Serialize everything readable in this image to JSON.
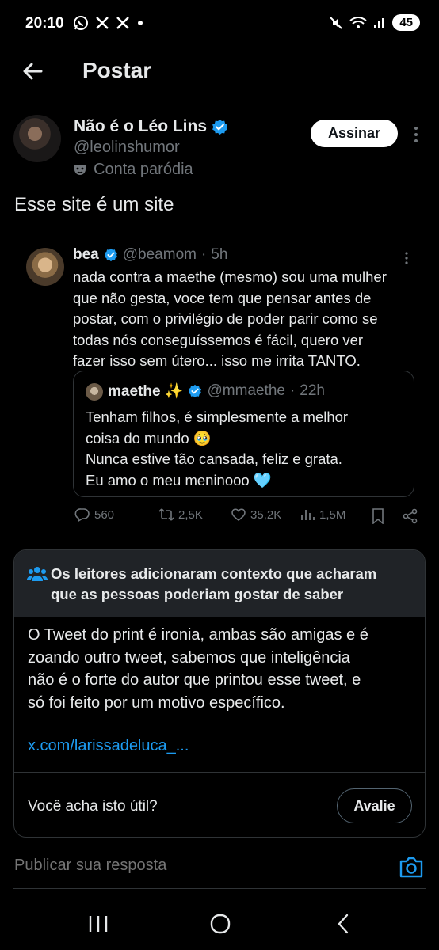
{
  "status_bar": {
    "time": "20:10",
    "left_icons": [
      "whatsapp-icon",
      "x-icon",
      "x-icon",
      "dot"
    ],
    "battery": "45"
  },
  "header": {
    "title": "Postar"
  },
  "post": {
    "author_name": "Não é o Léo Lins",
    "author_handle": "@leolinshumor",
    "parody_label": "Conta paródia",
    "subscribe_label": "Assinar",
    "text": "Esse site é um site"
  },
  "quoted": {
    "name": "bea",
    "handle": "@beamom",
    "sep": "·",
    "time": "5h",
    "lines": [
      "nada contra a maethe (mesmo) sou uma mulher",
      "que não gesta, voce tem que pensar antes de",
      "postar, com o privilégio de poder parir como se",
      "todas nós conseguíssemos é fácil, quero ver",
      "fazer isso sem útero... isso me irrita TANTO."
    ],
    "inner": {
      "name": "maethe ✨",
      "handle": "@mmaethe",
      "sep": "·",
      "time": "22h",
      "lines": [
        "Tenham filhos, é simplesmente a melhor",
        "coisa do mundo 🥹",
        "Nunca estive tão cansada, feliz e grata.",
        "Eu amo o meu meninooo 🩵"
      ]
    },
    "actions": {
      "replies": "560",
      "reposts": "2,5K",
      "likes": "35,2K",
      "views": "1,5M"
    }
  },
  "note": {
    "title_line1": "Os leitores adicionaram contexto que acharam",
    "title_line2": "que as pessoas poderiam gostar de saber",
    "body": [
      "O Tweet do print é ironia, ambas são amigas e é",
      "zoando outro tweet, sabemos que inteligência",
      "não é o forte do autor que printou esse tweet, e",
      "só foi feito por um motivo específico."
    ],
    "link": "x.com/larissadeluca_...",
    "question": "Você acha isto útil?",
    "rate_label": "Avalie"
  },
  "reply": {
    "placeholder": "Publicar sua resposta"
  },
  "colors": {
    "background": "#000000",
    "accent_blue": "#1d9bf0",
    "text": "#e7e9ea",
    "muted": "#71767b",
    "note_header": "#202327"
  }
}
